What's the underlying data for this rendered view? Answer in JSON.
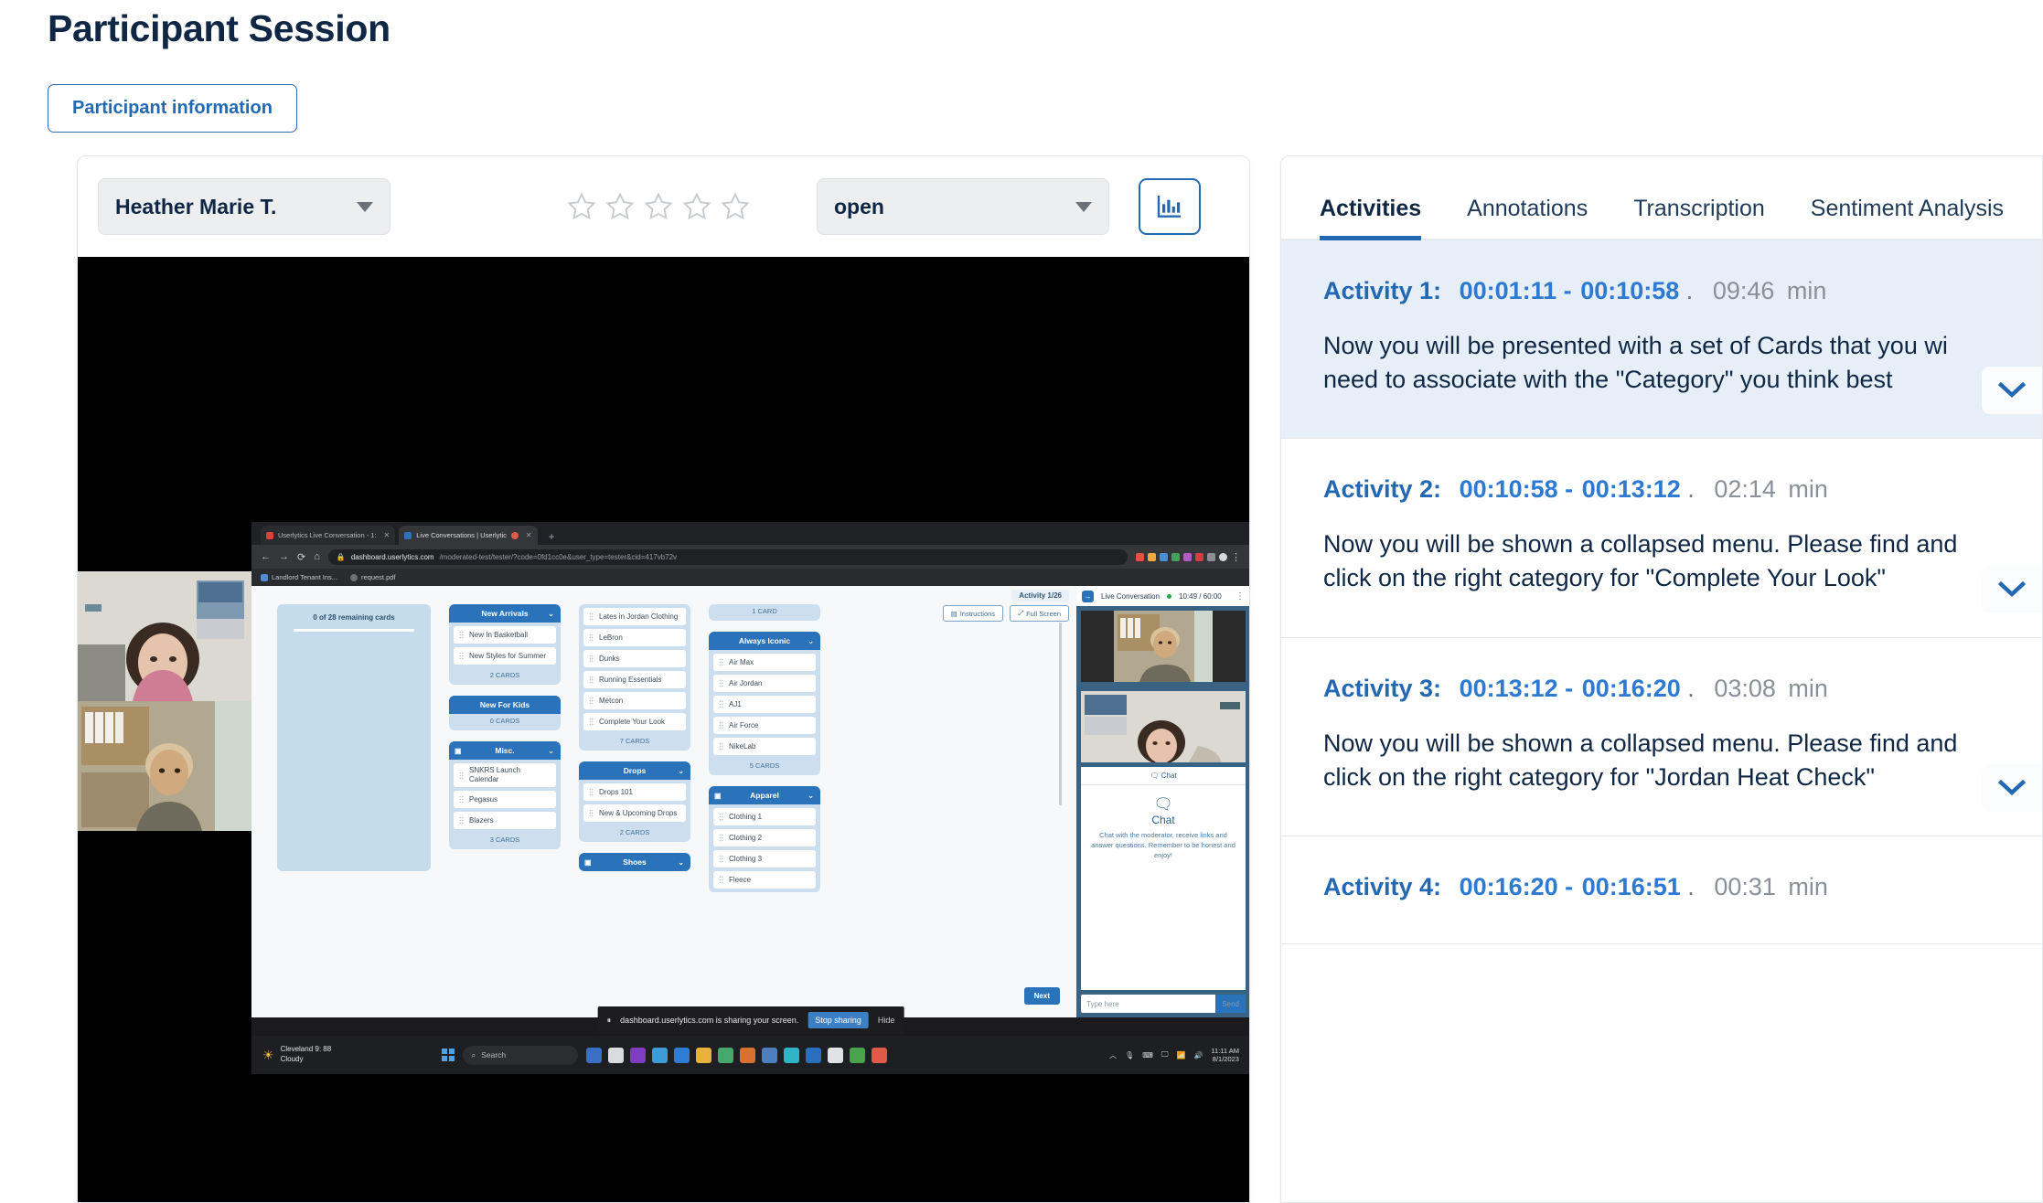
{
  "page": {
    "title": "Participant Session",
    "participant_info_button": "Participant information"
  },
  "player": {
    "participant_select": "Heather Marie T.",
    "status_select": "open",
    "rating": 0,
    "rating_max": 5,
    "chart_button_icon": "bar-chart-icon"
  },
  "shared_screen": {
    "browser": {
      "tabs": [
        {
          "title": "Userlytics Live Conversation - 1:",
          "active": false
        },
        {
          "title": "Live Conversations | Userlytic",
          "active": true
        }
      ],
      "new_tab_label": "+",
      "url_domain": "dashboard.userlytics.com",
      "url_path": "/moderated-test/tester/?code=0fd1cc0e&user_type=tester&cid=417vb72v",
      "bookmarks": [
        "Landlord Tenant Ins...",
        "request.pdf"
      ]
    },
    "card_sort": {
      "activity_counter": "Activity 1/26",
      "instructions_button": "Instructions",
      "fullscreen_button": "Full Screen",
      "pool_label": "0 of 28 remaining cards",
      "next_button": "Next",
      "columns": [
        {
          "groups": [
            {
              "title": "New Arrivals",
              "has_trash": false,
              "cards": [
                "New In Basketball",
                "New Styles for Summer"
              ],
              "count": "2 CARDS"
            },
            {
              "title": "New For Kids",
              "has_trash": false,
              "cards": [],
              "count": "0 CARDS"
            },
            {
              "title": "Misc.",
              "has_trash": true,
              "cards": [
                "SNKRS Launch Calendar",
                "Pegasus",
                "Blazers"
              ],
              "count": "3 CARDS"
            }
          ]
        },
        {
          "groups": [
            {
              "title": "",
              "has_trash": false,
              "cards": [
                "Lates in Jordan Clothing",
                "LeBron",
                "Dunks",
                "Running Essentials",
                "Metcon",
                "Complete Your Look"
              ],
              "count": "7 CARDS"
            },
            {
              "title": "Drops",
              "has_trash": false,
              "cards": [
                "Drops 101",
                "New & Upcoming Drops"
              ],
              "count": "2 CARDS"
            },
            {
              "title": "Shoes",
              "has_trash": true,
              "cards": [],
              "count": ""
            }
          ]
        },
        {
          "groups": [
            {
              "title": "",
              "has_trash": false,
              "cards": [],
              "count": "1 CARD"
            },
            {
              "title": "Always Iconic",
              "has_trash": false,
              "cards": [
                "Air Max",
                "Air Jordan",
                "AJ1",
                "Air Force",
                "NikeLab"
              ],
              "count": "5 CARDS"
            },
            {
              "title": "Apparel",
              "has_trash": true,
              "cards": [
                "Clothing 1",
                "Clothing 2",
                "Clothing 3",
                "Fleece"
              ],
              "count": ""
            }
          ]
        }
      ]
    },
    "live_conversation": {
      "title": "Live Conversation",
      "timer": "10:49 / 60:00",
      "chat_tab": "Chat",
      "chat_title": "Chat",
      "chat_description": "Chat with the moderator, receive links and answer questions. Remember to be honest and enjoy!",
      "chat_placeholder": "Type here",
      "send_button": "Send"
    },
    "share_bar": {
      "message": "dashboard.userlytics.com is sharing your screen.",
      "stop_button": "Stop sharing",
      "hide_button": "Hide"
    },
    "taskbar": {
      "weather_temp": "Cleveland 9: 88",
      "weather_desc": "Cloudy",
      "search_placeholder": "Search",
      "clock_time": "11:11 AM",
      "clock_date": "8/1/2023"
    }
  },
  "activities_panel": {
    "tabs": [
      {
        "label": "Activities",
        "active": true
      },
      {
        "label": "Annotations",
        "active": false
      },
      {
        "label": "Transcription",
        "active": false
      },
      {
        "label": "Sentiment Analysis",
        "active": false
      }
    ],
    "items": [
      {
        "label": "Activity 1:",
        "start": "00:01:11",
        "end": "00:10:58",
        "duration": "09:46",
        "duration_unit": "min",
        "description_line1": "Now you will be presented with a set of Cards that you wi",
        "description_line2": "need to associate with the \"Category\" you think best",
        "selected": true
      },
      {
        "label": "Activity 2:",
        "start": "00:10:58",
        "end": "00:13:12",
        "duration": "02:14",
        "duration_unit": "min",
        "description_line1": "Now you will be shown a collapsed menu. Please find and",
        "description_line2": "click on the right category for \"Complete Your Look\"",
        "selected": false
      },
      {
        "label": "Activity 3:",
        "start": "00:13:12",
        "end": "00:16:20",
        "duration": "03:08",
        "duration_unit": "min",
        "description_line1": "Now you will be shown a collapsed menu. Please find and",
        "description_line2": "click on the right category for \"Jordan Heat Check\"",
        "selected": false
      },
      {
        "label": "Activity 4:",
        "start": "00:16:20",
        "end": "00:16:51",
        "duration": "00:31",
        "duration_unit": "min",
        "description_line1": "",
        "description_line2": "",
        "selected": false
      }
    ],
    "expand_icon": "chevron-down-icon"
  },
  "colors": {
    "accent": "#2268b3",
    "link": "#2e7ad1",
    "heading": "#0f2744",
    "selected_row": "#e6eff8"
  }
}
